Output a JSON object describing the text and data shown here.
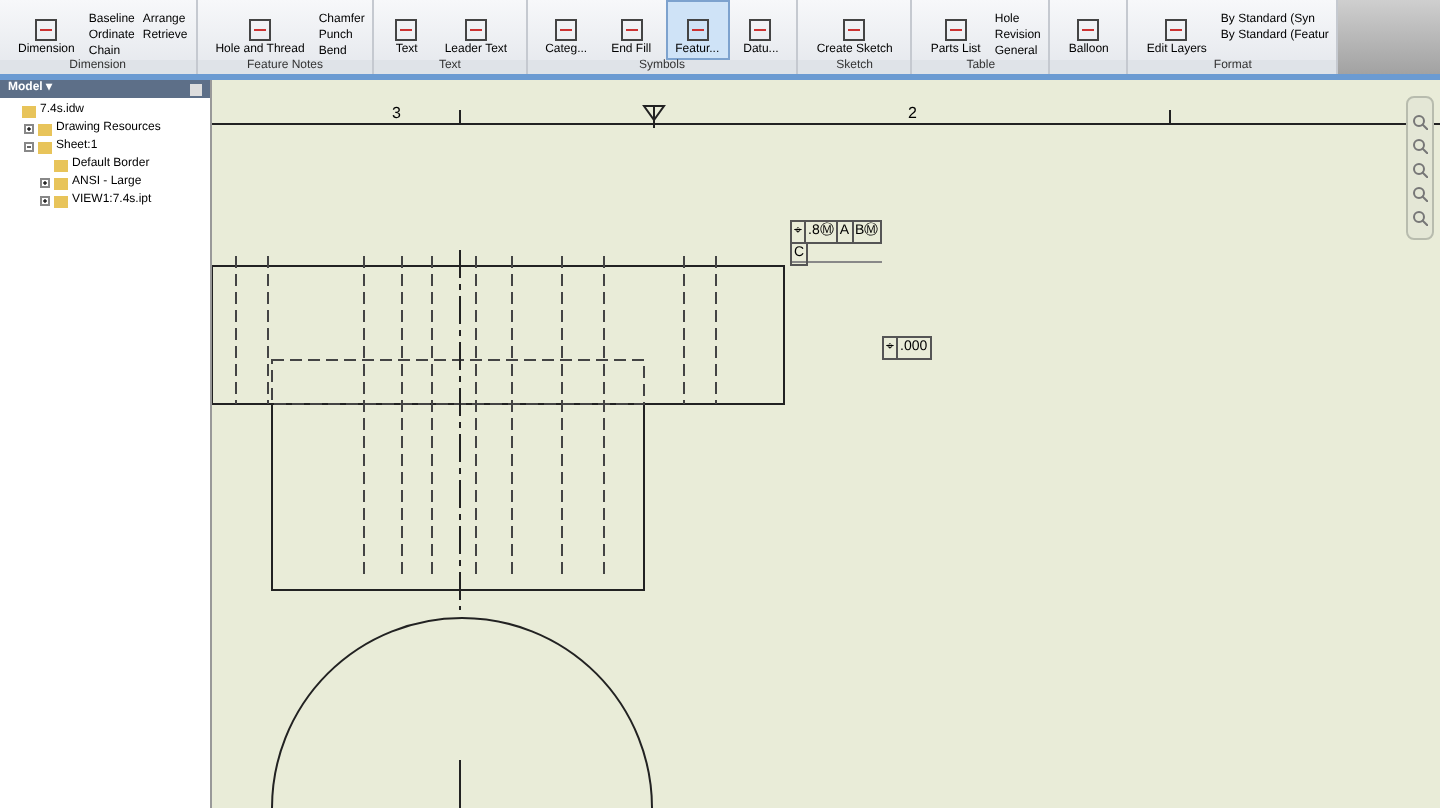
{
  "ribbon": {
    "panels": [
      {
        "label": "Dimension",
        "large": [
          {
            "label": "Dimension",
            "selected": false
          }
        ],
        "small": [
          "Baseline",
          "Ordinate",
          "Chain",
          "Arrange",
          "Retrieve"
        ]
      },
      {
        "label": "Feature Notes",
        "large": [
          {
            "label": "Hole and Thread",
            "selected": false
          }
        ],
        "small": [
          "Chamfer",
          "Punch",
          "Bend"
        ]
      },
      {
        "label": "Text",
        "large": [
          {
            "label": "Text",
            "selected": false
          },
          {
            "label": "Leader Text",
            "selected": false
          }
        ]
      },
      {
        "label": "Symbols",
        "large": [
          {
            "label": "Categ...",
            "selected": false
          },
          {
            "label": "End Fill",
            "selected": false
          },
          {
            "label": "Featur...",
            "selected": true
          },
          {
            "label": "Datu...",
            "selected": false
          }
        ]
      },
      {
        "label": "Sketch",
        "large": [
          {
            "label": "Create Sketch",
            "selected": false
          }
        ]
      },
      {
        "label": "Table",
        "large": [
          {
            "label": "Parts List",
            "selected": false
          }
        ],
        "small": [
          "Hole",
          "Revision",
          "General"
        ]
      },
      {
        "large": [
          {
            "label": "Balloon",
            "selected": false
          }
        ]
      },
      {
        "label": "Format",
        "large": [
          {
            "label": "Edit Layers",
            "selected": false
          }
        ],
        "small": [
          "By Standard (Syn",
          "By Standard (Featur"
        ]
      }
    ]
  },
  "browser": {
    "title": "Model ▾",
    "tree": [
      {
        "label": "7.4s.idw",
        "children": [
          {
            "label": "Drawing Resources",
            "expanded": false
          },
          {
            "label": "Sheet:1",
            "expanded": true,
            "children": [
              {
                "label": "Default Border"
              },
              {
                "label": "ANSI - Large",
                "expanded": false
              },
              {
                "label": "VIEW1:7.4s.ipt",
                "expanded": false
              }
            ]
          }
        ]
      }
    ]
  },
  "sheet": {
    "zones": [
      "3",
      "2"
    ],
    "frames": [
      {
        "cells": [
          "⌖",
          ".8Ⓜ",
          "A",
          "BⓂ"
        ],
        "datum": "C"
      },
      {
        "cells": [
          "⌖",
          ".000"
        ]
      }
    ]
  }
}
